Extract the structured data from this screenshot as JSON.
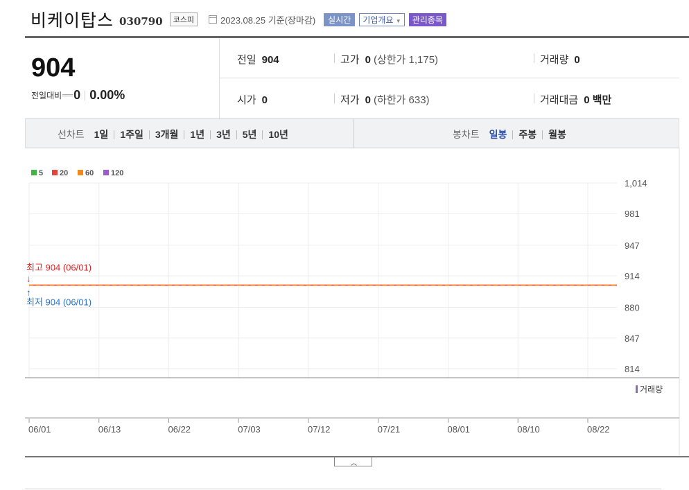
{
  "header": {
    "company_name": "비케이탑스",
    "code": "030790",
    "market": "코스피",
    "as_of": "2023.08.25 기준(장마감)",
    "realtime_label": "실시간",
    "company_info_label": "기업개요",
    "managed_label": "관리종목"
  },
  "summary": {
    "price": "904",
    "change_label": "전일대비",
    "change_value": "0",
    "change_pct": "0.00%",
    "prev_close_label": "전일",
    "prev_close": "904",
    "high_label": "고가",
    "high": "0",
    "upper_limit": "(상한가 1,175)",
    "volume_label": "거래량",
    "volume": "0",
    "open_label": "시가",
    "open": "0",
    "low_label": "저가",
    "low": "0",
    "lower_limit": "(하한가 633)",
    "amount_label": "거래대금",
    "amount": "0 백만"
  },
  "periods": {
    "line_chart_label": "선차트",
    "line_items": [
      "1일",
      "1주일",
      "3개월",
      "1년",
      "3년",
      "5년",
      "10년"
    ],
    "candle_chart_label": "봉차트",
    "candle_items": [
      "일봉",
      "주봉",
      "월봉"
    ],
    "candle_selected": 0
  },
  "colors": {
    "ma5": "#44b244",
    "ma20": "#e8443c",
    "ma60": "#f08a1c",
    "ma120": "#9b5ccb",
    "high_note": "#e02020",
    "low_note": "#2a72c8",
    "volume_marker": "#8a6fb0"
  },
  "chart_data": {
    "type": "line",
    "legend": [
      "5",
      "20",
      "60",
      "120"
    ],
    "x_ticks": [
      "06/01",
      "06/13",
      "06/22",
      "07/03",
      "07/12",
      "07/21",
      "08/01",
      "08/10",
      "08/22"
    ],
    "y_ticks": [
      "1,014",
      "981",
      "947",
      "914",
      "880",
      "847",
      "814"
    ],
    "y_tick_values": [
      1014,
      981,
      947,
      914,
      880,
      847,
      814
    ],
    "ylim": [
      814,
      1014
    ],
    "series": [
      {
        "name": "20",
        "x": [
          "06/01",
          "08/25"
        ],
        "values": [
          904,
          904
        ]
      },
      {
        "name": "60",
        "x": [
          "06/01",
          "08/25"
        ],
        "values": [
          904,
          904
        ]
      }
    ],
    "annotations": {
      "high": "최고 904 (06/01)",
      "low": "최저 904 (06/01)"
    },
    "volume_label": "거래량",
    "grid": true
  }
}
